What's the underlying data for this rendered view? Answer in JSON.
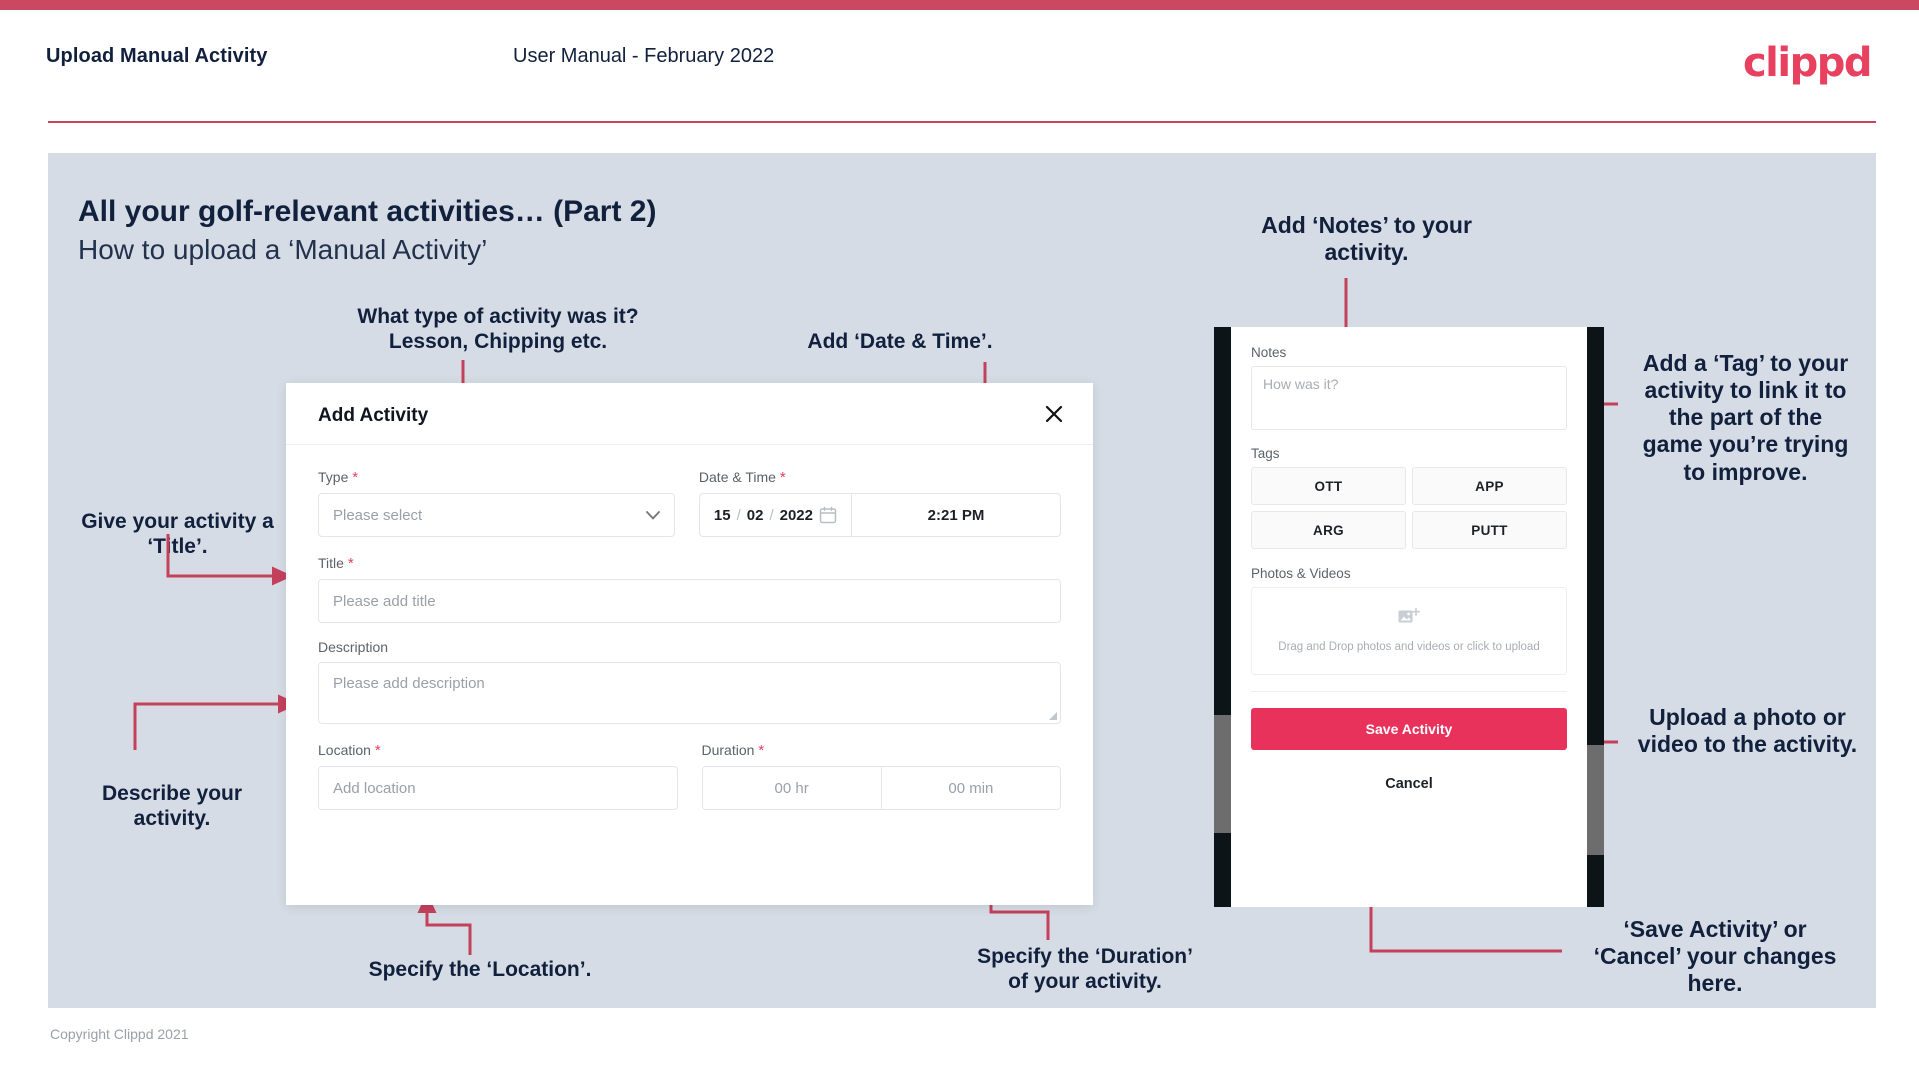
{
  "header": {
    "title": "Upload Manual Activity",
    "subtitle": "User Manual - February 2022",
    "logo": "clippd"
  },
  "slide": {
    "heading": "All your golf-relevant activities… (Part 2)",
    "subheading": "How to upload a ‘Manual Activity’",
    "copyright": "Copyright Clippd 2021"
  },
  "annotations": {
    "type": "What type of activity was it?\nLesson, Chipping etc.",
    "datetime": "Add ‘Date & Time’.",
    "title": "Give your activity a\n‘Title’.",
    "description": "Describe your\nactivity.",
    "location": "Specify the ‘Location’.",
    "duration": "Specify the ‘Duration’\nof your activity.",
    "notes": "Add ‘Notes’ to your\nactivity.",
    "tags": "Add a ‘Tag’ to your\nactivity to link it to\nthe part of the\ngame you’re trying\nto improve.",
    "upload": "Upload a photo or\nvideo to the activity.",
    "save": "‘Save Activity’ or\n‘Cancel’ your changes\nhere."
  },
  "modal": {
    "title": "Add Activity",
    "close_icon": "close-icon",
    "fields": {
      "type": {
        "label": "Type",
        "required": "*",
        "placeholder": "Please select",
        "chevron": "chevron-down-icon"
      },
      "datetime": {
        "label": "Date & Time",
        "required": "*",
        "day": "15",
        "sep1": "/",
        "month": "02",
        "sep2": "/",
        "year": "2022",
        "calendar_icon": "calendar-icon",
        "time": "2:21 PM"
      },
      "title": {
        "label": "Title",
        "required": "*",
        "placeholder": "Please add title"
      },
      "description": {
        "label": "Description",
        "placeholder": "Please add description"
      },
      "location": {
        "label": "Location",
        "required": "*",
        "placeholder": "Add location"
      },
      "duration": {
        "label": "Duration",
        "required": "*",
        "hours_placeholder": "00 hr",
        "minutes_placeholder": "00 min"
      }
    }
  },
  "phone": {
    "notes_label": "Notes",
    "notes_placeholder": "How was it?",
    "tags_label": "Tags",
    "tags": [
      "OTT",
      "APP",
      "ARG",
      "PUTT"
    ],
    "photos_label": "Photos & Videos",
    "dropzone_icon": "add-image-icon",
    "dropzone_text": "Drag and Drop photos and videos or\nclick to upload",
    "save_label": "Save Activity",
    "cancel_label": "Cancel"
  },
  "colors": {
    "brand_pink": "#e8415f",
    "top_bar": "#cb4862",
    "save_button": "#e8325b",
    "slide_bg": "#d6dce5",
    "arrow": "#c4415c",
    "text_dark": "#11203c"
  }
}
